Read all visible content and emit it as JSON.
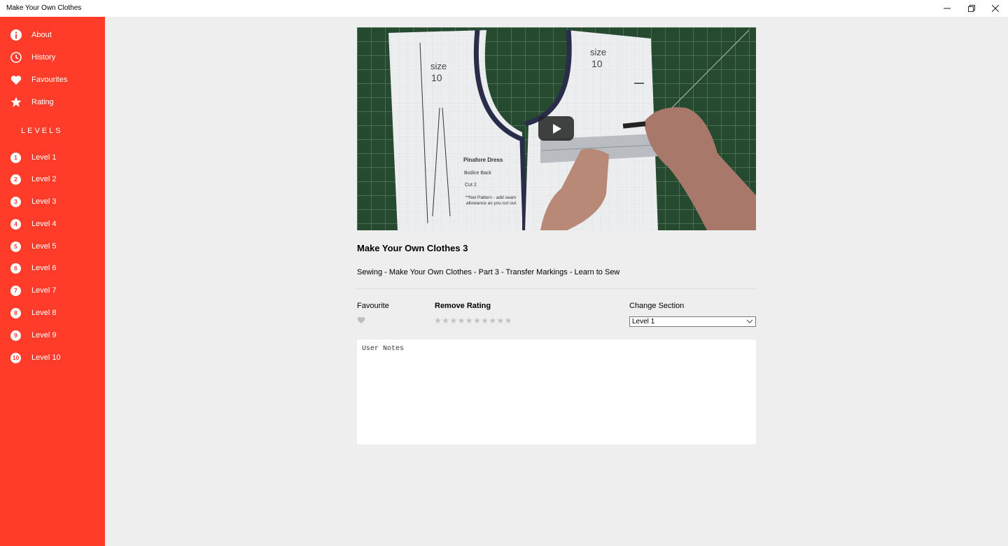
{
  "window": {
    "title": "Make Your Own Clothes"
  },
  "sidebar": {
    "menu": [
      {
        "label": "About",
        "icon": "info-icon"
      },
      {
        "label": "History",
        "icon": "clock-icon"
      },
      {
        "label": "Favourites",
        "icon": "heart-icon"
      },
      {
        "label": "Rating",
        "icon": "star-icon"
      }
    ],
    "levels_heading": "LEVELS",
    "levels": [
      {
        "num": "1",
        "label": "Level 1"
      },
      {
        "num": "2",
        "label": "Level 2"
      },
      {
        "num": "3",
        "label": "Level 3"
      },
      {
        "num": "4",
        "label": "Level 4"
      },
      {
        "num": "5",
        "label": "Level 5"
      },
      {
        "num": "6",
        "label": "Level 6"
      },
      {
        "num": "7",
        "label": "Level 7"
      },
      {
        "num": "8",
        "label": "Level 8"
      },
      {
        "num": "9",
        "label": "Level 9"
      },
      {
        "num": "10",
        "label": "Level 10"
      }
    ]
  },
  "video": {
    "title": "Make Your Own Clothes 3",
    "description": "Sewing - Make Your Own Clothes - Part 3 - Transfer Markings - Learn to Sew",
    "thumbnail_text": {
      "size_left": "size",
      "size_left_num": "10",
      "size_right": "size",
      "size_right_num": "10",
      "pattern_name": "Pinafore Dress",
      "pattern_piece": "Bodice Back",
      "cut": "Cut 2",
      "note1": "**Net Pattern - add seam",
      "note2": "allowance as you cut out"
    }
  },
  "controls": {
    "favourite_label": "Favourite",
    "rating_label": "Remove Rating",
    "star_count": 10,
    "stars": [
      "★",
      "★",
      "★",
      "★",
      "★",
      "★",
      "★",
      "★",
      "★",
      "★"
    ],
    "section_label": "Change Section",
    "section_value": "Level 1"
  },
  "notes": {
    "placeholder": "User Notes"
  },
  "colors": {
    "accent": "#ff3b29",
    "background": "#eeeeee"
  }
}
